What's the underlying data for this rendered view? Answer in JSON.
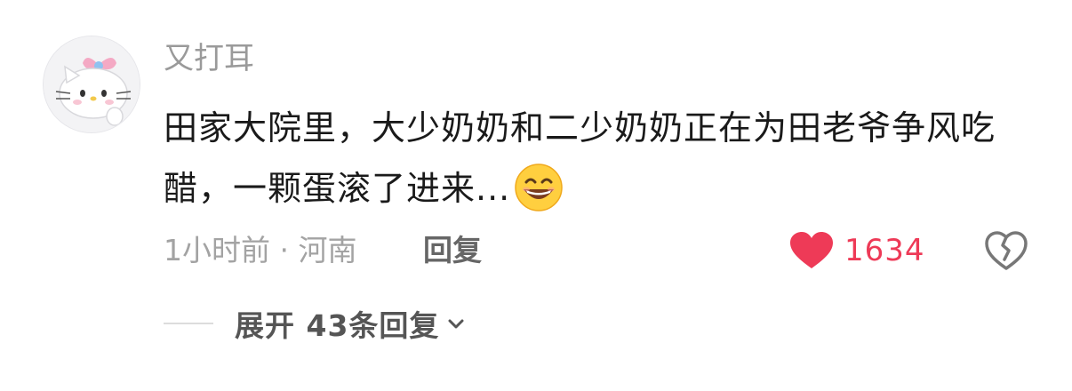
{
  "comment": {
    "username": "又打耳",
    "text": "田家大院里，大少奶奶和二少奶奶正在为田老爷争风吃醋，一颗蛋滚了进来...",
    "emoji": "grinning-face-emoji",
    "meta": "1小时前 · 河南",
    "reply_label": "回复",
    "like_count": "1634",
    "like_icon": "heart-icon",
    "dislike_icon": "broken-heart-icon",
    "expand_label": "展开 43条回复",
    "like_color": "#ee3a57"
  }
}
